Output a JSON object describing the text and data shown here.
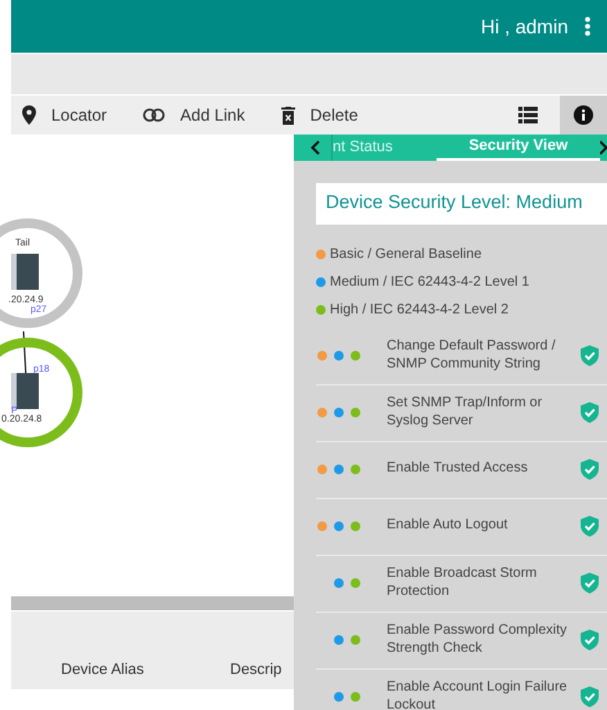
{
  "header": {
    "greeting": "Hi , admin"
  },
  "toolbar": {
    "buttons": [
      {
        "kind": "locator",
        "label": "Locator"
      },
      {
        "kind": "link",
        "label": "Add Link"
      },
      {
        "kind": "delete",
        "label": "Delete"
      }
    ]
  },
  "topology": {
    "nodes": [
      {
        "role": "Tail",
        "ip": ".20.24.9",
        "port": "p27",
        "color": "#c4c4c4"
      },
      {
        "ip": "0.20.24.8",
        "port": "p18",
        "port_2": "P",
        "color": "#7cbd1c"
      }
    ]
  },
  "table": {
    "columns": [
      "Device Alias",
      "Descrip"
    ]
  },
  "panel": {
    "tabs": [
      {
        "label": "nt Status",
        "selected": false
      },
      {
        "label": "Security View",
        "selected": true
      }
    ],
    "title": "Device Security Level: Medium",
    "legend": [
      {
        "label": "Basic / General Baseline",
        "color": "#f39a44"
      },
      {
        "label": "Medium / IEC 62443-4-2 Level 1",
        "color": "#1e9be8"
      },
      {
        "label": "High / IEC 62443-4-2 Level 2",
        "color": "#7cbd1c"
      }
    ],
    "items": [
      {
        "label": "Change Default Password / SNMP Community String",
        "basic": true,
        "medium": true,
        "high": true,
        "passed": true
      },
      {
        "label": "Set SNMP Trap/Inform or Syslog Server",
        "basic": true,
        "medium": true,
        "high": true,
        "passed": true
      },
      {
        "label": "Enable Trusted Access",
        "basic": true,
        "medium": true,
        "high": true,
        "passed": true
      },
      {
        "label": "Enable Auto Logout",
        "basic": true,
        "medium": true,
        "high": true,
        "passed": true
      },
      {
        "label": "Enable Broadcast Storm Protection",
        "basic": false,
        "medium": true,
        "high": true,
        "passed": true
      },
      {
        "label": "Enable Password Complexity Strength Check",
        "basic": false,
        "medium": true,
        "high": true,
        "passed": true
      },
      {
        "label": "Enable Account Login Failure Lockout",
        "basic": false,
        "medium": true,
        "high": true,
        "passed": true
      }
    ]
  }
}
